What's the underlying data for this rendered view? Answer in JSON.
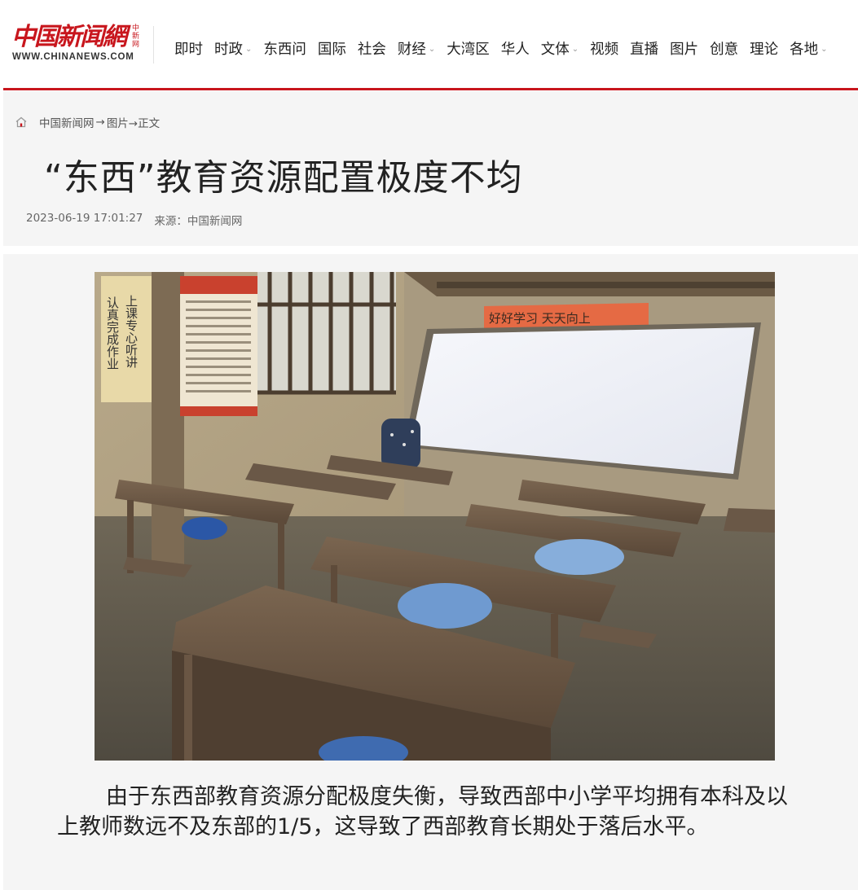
{
  "logo": {
    "cn": "中国新闻網",
    "side": "中新网",
    "en": "WWW.CHINANEWS.COM"
  },
  "nav": [
    {
      "label": "即时",
      "dropdown": false
    },
    {
      "label": "时政",
      "dropdown": true
    },
    {
      "label": "东西问",
      "dropdown": false
    },
    {
      "label": "国际",
      "dropdown": false
    },
    {
      "label": "社会",
      "dropdown": false
    },
    {
      "label": "财经",
      "dropdown": true
    },
    {
      "label": "大湾区",
      "dropdown": false
    },
    {
      "label": "华人",
      "dropdown": false
    },
    {
      "label": "文体",
      "dropdown": true
    },
    {
      "label": "视频",
      "dropdown": false
    },
    {
      "label": "直播",
      "dropdown": false
    },
    {
      "label": "图片",
      "dropdown": false
    },
    {
      "label": "创意",
      "dropdown": false
    },
    {
      "label": "理论",
      "dropdown": false
    },
    {
      "label": "各地",
      "dropdown": true
    }
  ],
  "breadcrumb": {
    "home": "中国新闻网",
    "sep": "→",
    "section": "图片→正文"
  },
  "article": {
    "title": "“东西”教育资源配置极度不均",
    "datetime": "2023-06-19 17:01:27",
    "source": "来源：中国新闻网",
    "caption": "由于东西部教育资源分配极度失衡，导致西部中小学平均拥有本科及以上教师数远不及东部的1/5，这导致了西部教育长期处于落后水平。"
  },
  "photo": {
    "poster_left": "认真完成作业",
    "poster_left2": "上课专心听讲",
    "banner": "好好学习  天天向上"
  },
  "colors": {
    "brand_red": "#c8161d",
    "panel_bg": "#f5f5f5"
  }
}
